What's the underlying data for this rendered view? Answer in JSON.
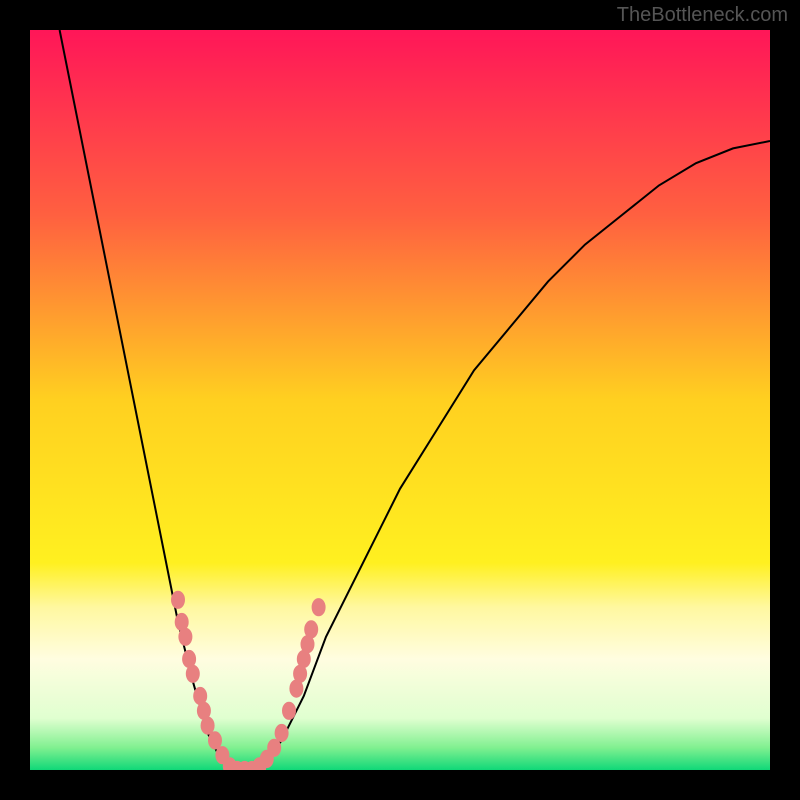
{
  "watermark": "TheBottleneck.com",
  "chart_data": {
    "type": "line",
    "title": "",
    "xlabel": "",
    "ylabel": "",
    "xlim": [
      0,
      100
    ],
    "ylim": [
      0,
      100
    ],
    "background_gradient": {
      "stops": [
        {
          "offset": 0,
          "color": "#ff1658"
        },
        {
          "offset": 0.25,
          "color": "#ff6040"
        },
        {
          "offset": 0.5,
          "color": "#ffd020"
        },
        {
          "offset": 0.72,
          "color": "#fff020"
        },
        {
          "offset": 0.78,
          "color": "#fff8a0"
        },
        {
          "offset": 0.85,
          "color": "#fffde0"
        },
        {
          "offset": 0.93,
          "color": "#e0ffd0"
        },
        {
          "offset": 0.97,
          "color": "#80f090"
        },
        {
          "offset": 1.0,
          "color": "#10d878"
        }
      ]
    },
    "series": [
      {
        "name": "bottleneck-curve",
        "type": "line",
        "color": "#000000",
        "stroke_width": 2,
        "points": [
          {
            "x": 4,
            "y": 100
          },
          {
            "x": 6,
            "y": 90
          },
          {
            "x": 8,
            "y": 80
          },
          {
            "x": 10,
            "y": 70
          },
          {
            "x": 12,
            "y": 60
          },
          {
            "x": 14,
            "y": 50
          },
          {
            "x": 16,
            "y": 40
          },
          {
            "x": 18,
            "y": 30
          },
          {
            "x": 20,
            "y": 20
          },
          {
            "x": 22,
            "y": 12
          },
          {
            "x": 24,
            "y": 5
          },
          {
            "x": 26,
            "y": 1
          },
          {
            "x": 28,
            "y": 0
          },
          {
            "x": 30,
            "y": 0
          },
          {
            "x": 32,
            "y": 1
          },
          {
            "x": 34,
            "y": 4
          },
          {
            "x": 37,
            "y": 10
          },
          {
            "x": 40,
            "y": 18
          },
          {
            "x": 45,
            "y": 28
          },
          {
            "x": 50,
            "y": 38
          },
          {
            "x": 55,
            "y": 46
          },
          {
            "x": 60,
            "y": 54
          },
          {
            "x": 65,
            "y": 60
          },
          {
            "x": 70,
            "y": 66
          },
          {
            "x": 75,
            "y": 71
          },
          {
            "x": 80,
            "y": 75
          },
          {
            "x": 85,
            "y": 79
          },
          {
            "x": 90,
            "y": 82
          },
          {
            "x": 95,
            "y": 84
          },
          {
            "x": 100,
            "y": 85
          }
        ]
      },
      {
        "name": "data-markers",
        "type": "scatter",
        "color": "#e88080",
        "marker_size": 7,
        "points": [
          {
            "x": 20,
            "y": 23
          },
          {
            "x": 20.5,
            "y": 20
          },
          {
            "x": 21,
            "y": 18
          },
          {
            "x": 21.5,
            "y": 15
          },
          {
            "x": 22,
            "y": 13
          },
          {
            "x": 23,
            "y": 10
          },
          {
            "x": 23.5,
            "y": 8
          },
          {
            "x": 24,
            "y": 6
          },
          {
            "x": 25,
            "y": 4
          },
          {
            "x": 26,
            "y": 2
          },
          {
            "x": 27,
            "y": 0.5
          },
          {
            "x": 28,
            "y": 0
          },
          {
            "x": 29,
            "y": 0
          },
          {
            "x": 30,
            "y": 0
          },
          {
            "x": 31,
            "y": 0.5
          },
          {
            "x": 32,
            "y": 1.5
          },
          {
            "x": 33,
            "y": 3
          },
          {
            "x": 34,
            "y": 5
          },
          {
            "x": 35,
            "y": 8
          },
          {
            "x": 36,
            "y": 11
          },
          {
            "x": 36.5,
            "y": 13
          },
          {
            "x": 37,
            "y": 15
          },
          {
            "x": 37.5,
            "y": 17
          },
          {
            "x": 38,
            "y": 19
          },
          {
            "x": 39,
            "y": 22
          }
        ]
      }
    ]
  }
}
